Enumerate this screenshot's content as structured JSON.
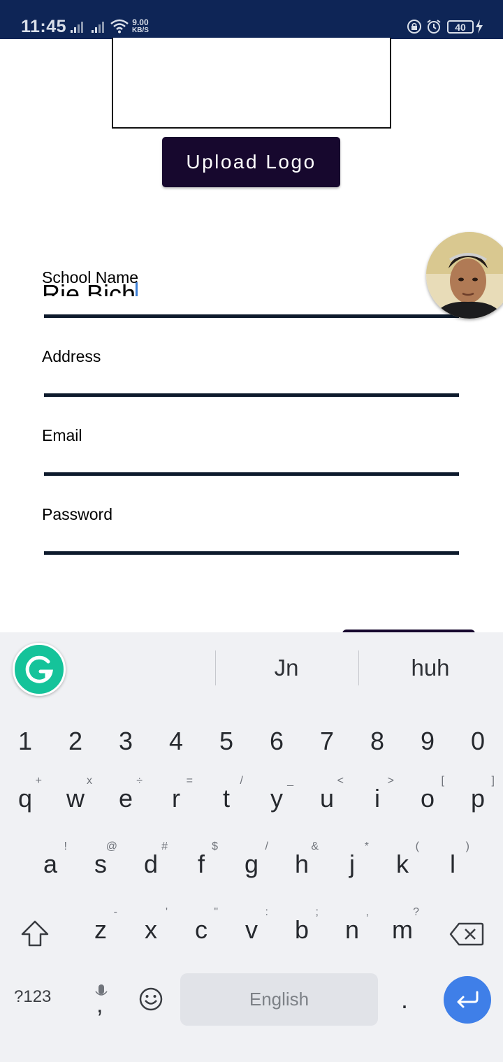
{
  "status_bar": {
    "time": "11:45",
    "net_speed_value": "9.00",
    "net_speed_unit": "KB/S",
    "battery_level": "40",
    "background_color": "#0e2556"
  },
  "logo_section": {
    "upload_button_label": "Upload Logo",
    "button_color": "#17082e"
  },
  "form": {
    "school_name": {
      "label": "School Name",
      "value_head": "Rie  Bi",
      "value_tail": "ch"
    },
    "address": {
      "label": "Address",
      "value": ""
    },
    "email": {
      "label": "Email",
      "value": ""
    },
    "password": {
      "label": "Password",
      "value": ""
    }
  },
  "keyboard": {
    "suggestions": [
      "Jn",
      "huh"
    ],
    "number_row": [
      "1",
      "2",
      "3",
      "4",
      "5",
      "6",
      "7",
      "8",
      "9",
      "0"
    ],
    "row1": [
      {
        "key": "q",
        "hint": "+"
      },
      {
        "key": "w",
        "hint": "x"
      },
      {
        "key": "e",
        "hint": "÷"
      },
      {
        "key": "r",
        "hint": "="
      },
      {
        "key": "t",
        "hint": "/"
      },
      {
        "key": "y",
        "hint": "_"
      },
      {
        "key": "u",
        "hint": "<"
      },
      {
        "key": "i",
        "hint": ">"
      },
      {
        "key": "o",
        "hint": "["
      },
      {
        "key": "p",
        "hint": "]"
      }
    ],
    "row2": [
      {
        "key": "a",
        "hint": "!"
      },
      {
        "key": "s",
        "hint": "@"
      },
      {
        "key": "d",
        "hint": "#"
      },
      {
        "key": "f",
        "hint": "$"
      },
      {
        "key": "g",
        "hint": "/"
      },
      {
        "key": "h",
        "hint": "&"
      },
      {
        "key": "j",
        "hint": "*"
      },
      {
        "key": "k",
        "hint": "("
      },
      {
        "key": "l",
        "hint": ")"
      }
    ],
    "row3": [
      {
        "key": "z",
        "hint": "-"
      },
      {
        "key": "x",
        "hint": "'"
      },
      {
        "key": "c",
        "hint": "\""
      },
      {
        "key": "v",
        "hint": ":"
      },
      {
        "key": "b",
        "hint": ";"
      },
      {
        "key": "n",
        "hint": ","
      },
      {
        "key": "m",
        "hint": "?"
      }
    ],
    "symbols_label": "?123",
    "comma_label": ",",
    "space_label": "English",
    "period_label": ".",
    "enter_color": "#3f7fe8",
    "grammarly_color": "#15c39a"
  }
}
